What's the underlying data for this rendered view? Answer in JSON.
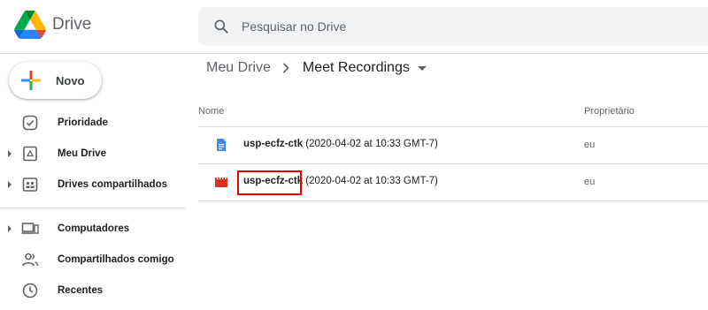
{
  "app": {
    "name": "Drive"
  },
  "search": {
    "placeholder": "Pesquisar no Drive"
  },
  "new_button": {
    "label": "Novo"
  },
  "sidebar": {
    "items": [
      {
        "label": "Prioridade",
        "icon": "priority-icon",
        "expandable": false
      },
      {
        "label": "Meu Drive",
        "icon": "my-drive-icon",
        "expandable": true
      },
      {
        "label": "Drives compartilhados",
        "icon": "shared-drives-icon",
        "expandable": true
      },
      {
        "label": "Computadores",
        "icon": "computers-icon",
        "expandable": true
      },
      {
        "label": "Compartilhados comigo",
        "icon": "shared-with-me-icon",
        "expandable": false
      },
      {
        "label": "Recentes",
        "icon": "recent-icon",
        "expandable": false
      }
    ]
  },
  "breadcrumb": {
    "root": "Meu Drive",
    "current": "Meet Recordings"
  },
  "table": {
    "columns": {
      "name": "Nome",
      "owner": "Proprietário"
    },
    "rows": [
      {
        "name_main": "usp-ecfz-ctk",
        "name_suffix": " (2020-04-02 at 10:33 GMT-7)",
        "owner": "eu",
        "icon": "document-icon",
        "icon_color": "#4285f4"
      },
      {
        "name_main": "usp-ecfz-ctk",
        "name_suffix": " (2020-04-02 at 10:33 GMT-7)",
        "owner": "eu",
        "icon": "video-icon",
        "icon_color": "#d93025"
      }
    ]
  },
  "colors": {
    "highlight": "#e60000",
    "search_bg": "#f1f3f4",
    "divider": "#dadce0"
  }
}
